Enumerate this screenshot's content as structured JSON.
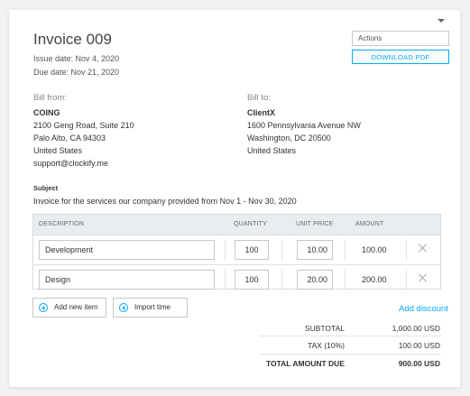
{
  "header": {
    "title": "Invoice 009",
    "issue_date": "Issue date: Nov 4, 2020",
    "due_date": "Due date: Nov 21, 2020",
    "actions_label": "Actions",
    "download_label": "DOWNLOAD PDF"
  },
  "bill_from": {
    "label": "Bill from:",
    "name": "COING",
    "address1": "2100 Geng Road, Suite 210",
    "address2": "Palo Alto, CA 94303",
    "country": "United States",
    "email": "support@clockify.me"
  },
  "bill_to": {
    "label": "Bill to:",
    "name": "ClientX",
    "address1": "1600 Pennsylvania Avenue NW",
    "address2": "Washington, DC 20500",
    "country": "United States"
  },
  "subject": {
    "label": "Subject",
    "text": "Invoice for the services our company provided from Nov 1 - Nov 30, 2020"
  },
  "table": {
    "columns": [
      "DESCRIPTION",
      "QUANTITY",
      "UNIT PRICE",
      "AMOUNT"
    ],
    "rows": [
      {
        "description": "Development",
        "quantity": "100",
        "unit_price": "10.00",
        "amount": "100.00"
      },
      {
        "description": "Design",
        "quantity": "100",
        "unit_price": "20.00",
        "amount": "200.00"
      }
    ]
  },
  "buttons": {
    "add_item": "Add new item",
    "import_time": "Import time",
    "add_discount": "Add discount"
  },
  "summary": {
    "subtotal_label": "SUBTOTAL",
    "subtotal_value": "1,000.00 USD",
    "tax_label": "TAX  (10%)",
    "tax_value": "100.00 USD",
    "total_label": "TOTAL AMOUNT DUE",
    "total_value": "900.00 USD"
  },
  "colors": {
    "accent": "#03a9f4",
    "table_header_bg": "#eaedf0"
  }
}
